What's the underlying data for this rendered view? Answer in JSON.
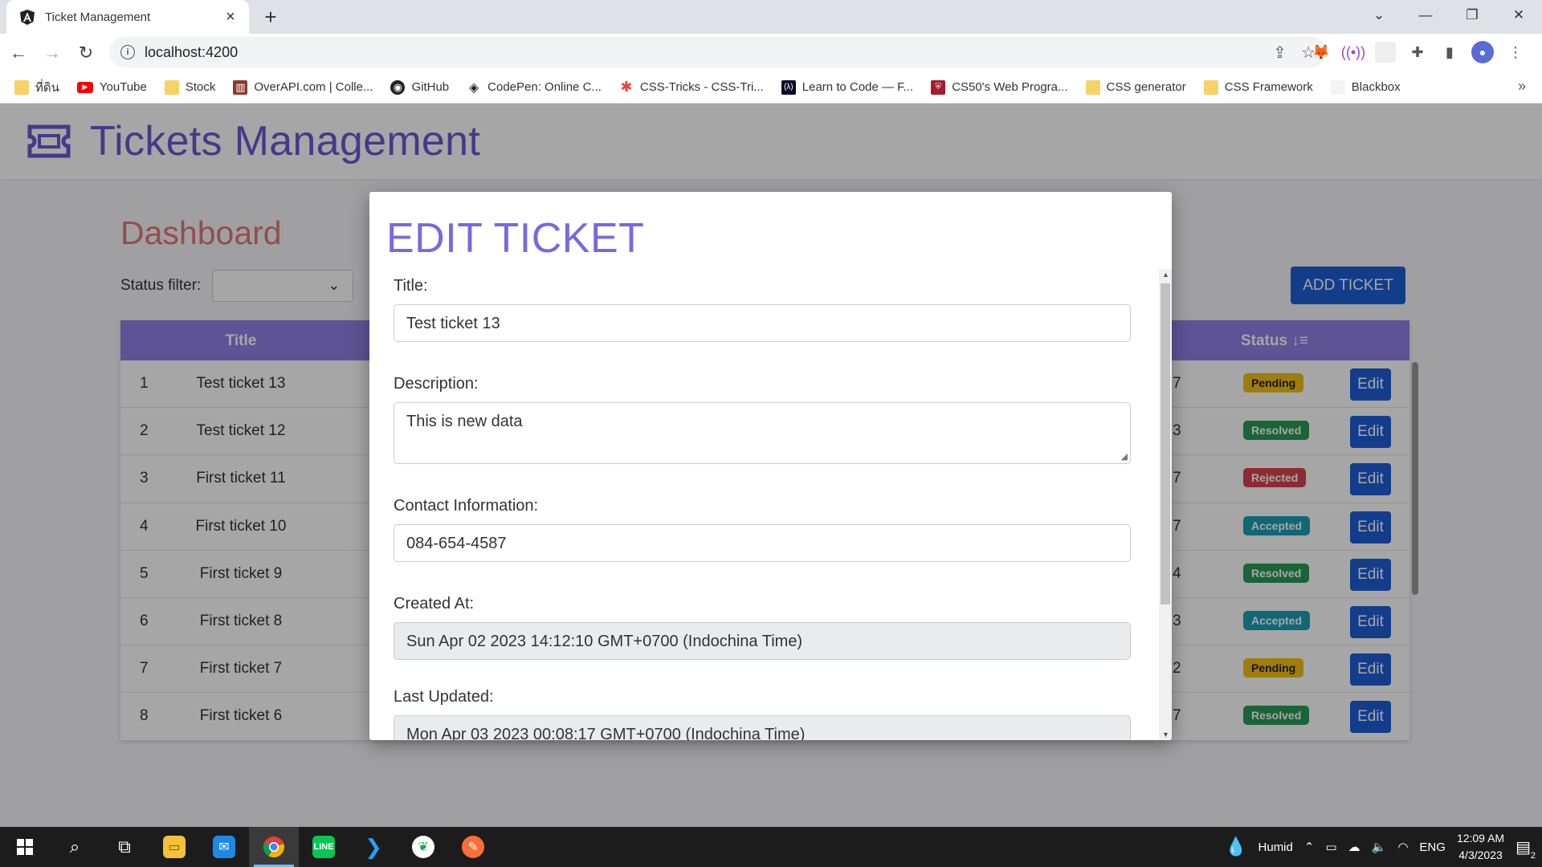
{
  "browser": {
    "tab_title": "Ticket Management",
    "url": "localhost:4200",
    "bookmarks": [
      {
        "label": "ที่ดิน",
        "icon": "folder-icon"
      },
      {
        "label": "YouTube",
        "icon": "youtube-icon"
      },
      {
        "label": "Stock",
        "icon": "folder-icon"
      },
      {
        "label": "OverAPI.com | Colle...",
        "icon": "overapi-icon"
      },
      {
        "label": "GitHub",
        "icon": "github-icon"
      },
      {
        "label": "CodePen: Online C...",
        "icon": "codepen-icon"
      },
      {
        "label": "CSS-Tricks - CSS-Tri...",
        "icon": "csstricks-icon"
      },
      {
        "label": "Learn to Code — F...",
        "icon": "freecodecamp-icon"
      },
      {
        "label": "CS50's Web Progra...",
        "icon": "harvard-icon"
      },
      {
        "label": "CSS generator",
        "icon": "folder-icon"
      },
      {
        "label": "CSS Framework",
        "icon": "folder-icon"
      },
      {
        "label": "Blackbox",
        "icon": "blackbox-icon"
      }
    ]
  },
  "app": {
    "title": "Tickets Management",
    "dashboard_title": "Dashboard",
    "status_filter_label": "Status filter:",
    "add_ticket_label": "ADD TICKET",
    "columns": {
      "title": "Title",
      "status": "Status ↓≡"
    },
    "rows": [
      {
        "num": "1",
        "title": "Test ticket 13",
        "frag": "7",
        "status": "Pending",
        "cls": "pending"
      },
      {
        "num": "2",
        "title": "Test ticket 12",
        "frag": "3",
        "status": "Resolved",
        "cls": "resolved"
      },
      {
        "num": "3",
        "title": "First ticket 11",
        "frag": "7",
        "status": "Rejected",
        "cls": "rejected"
      },
      {
        "num": "4",
        "title": "First ticket 10",
        "frag": "7",
        "status": "Accepted",
        "cls": "accepted"
      },
      {
        "num": "5",
        "title": "First ticket 9",
        "frag": "4",
        "status": "Resolved",
        "cls": "resolved"
      },
      {
        "num": "6",
        "title": "First ticket 8",
        "frag": "3",
        "status": "Accepted",
        "cls": "accepted"
      },
      {
        "num": "7",
        "title": "First ticket 7",
        "frag": "2",
        "status": "Pending",
        "cls": "pending"
      },
      {
        "num": "8",
        "title": "First ticket 6",
        "frag": "7",
        "status": "Resolved",
        "cls": "resolved"
      }
    ],
    "edit_label": "Edit"
  },
  "modal": {
    "heading": "EDIT TICKET",
    "title_label": "Title:",
    "title_value": "Test ticket 13",
    "description_label": "Description:",
    "description_value": "This is new data",
    "contact_label": "Contact Information:",
    "contact_value": "084-654-4587",
    "created_label": "Created At:",
    "created_value": "Sun Apr 02 2023 14:12:10 GMT+0700 (Indochina Time)",
    "updated_label": "Last Updated:",
    "updated_value": "Mon Apr 03 2023 00:08:17 GMT+0700 (Indochina Time)"
  },
  "taskbar": {
    "weather": "Humid",
    "language": "ENG",
    "time": "12:09 AM",
    "date": "4/3/2023",
    "notifications": "2"
  }
}
